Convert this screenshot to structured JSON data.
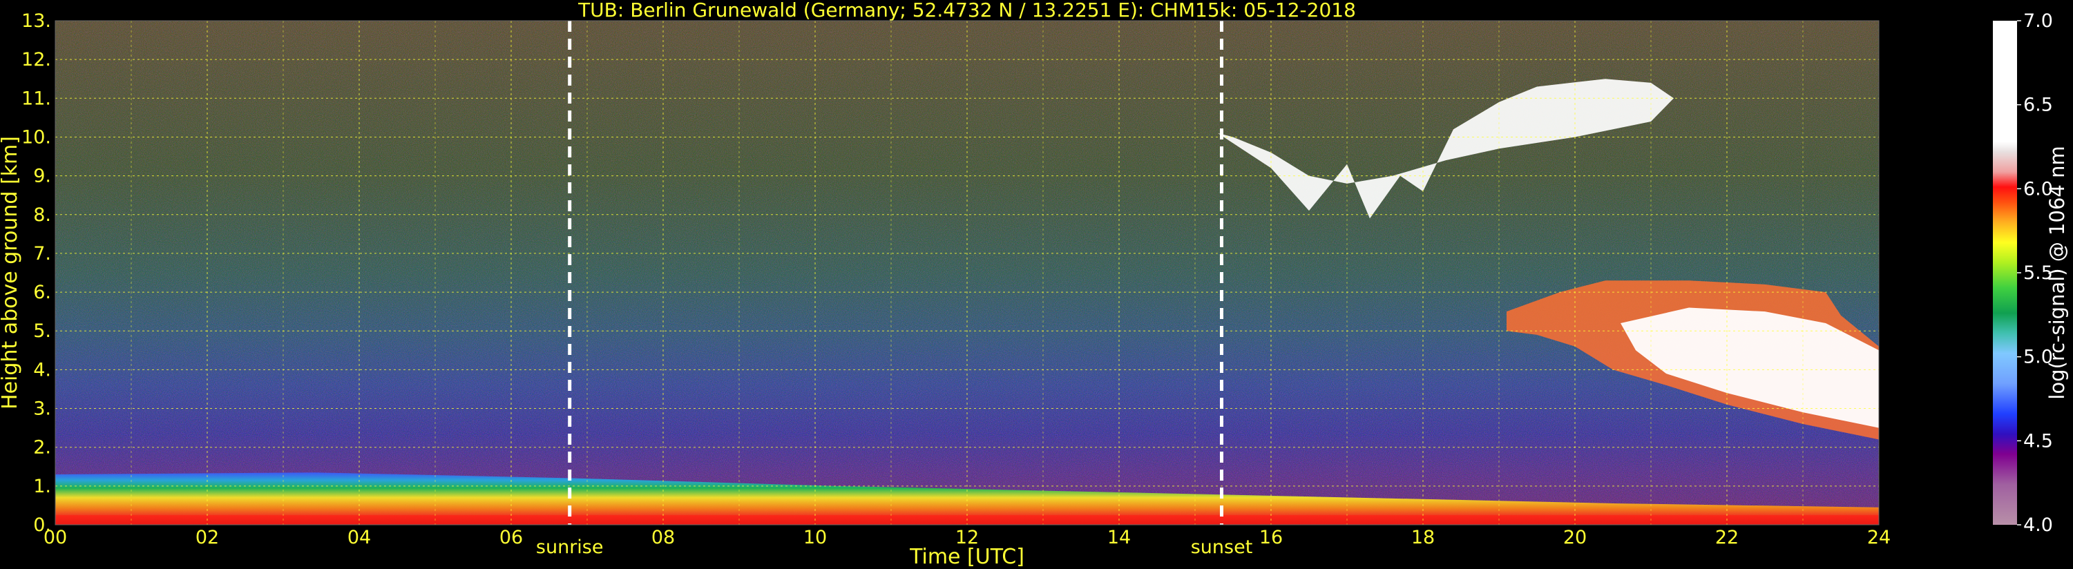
{
  "chart_data": {
    "type": "heatmap",
    "title": "TUB: Berlin Grunewald (Germany; 52.4732 N / 13.2251 E):    CHM15k: 05-12-2018",
    "xlabel": "Time [UTC]",
    "ylabel": "Height above ground [km]",
    "xlim": [
      0,
      24
    ],
    "ylim": [
      0,
      13
    ],
    "x_ticks": [
      "00",
      "02",
      "04",
      "06",
      "08",
      "10",
      "12",
      "14",
      "16",
      "18",
      "20",
      "22",
      "24"
    ],
    "y_ticks": [
      "0.",
      "1.",
      "2.",
      "3.",
      "4.",
      "5.",
      "6.",
      "7.",
      "8.",
      "9.",
      "10.",
      "11.",
      "12.",
      "13."
    ],
    "grid": true,
    "colorbar": {
      "label": "log(rc-signal) @ 1064 nm",
      "range": [
        4.0,
        7.0
      ],
      "ticks": [
        "4.0",
        "4.5",
        "5.0",
        "5.5",
        "6.0",
        "6.5",
        "7.0"
      ]
    },
    "markers": [
      {
        "label": "sunrise",
        "x": 6.77
      },
      {
        "label": "sunset",
        "x": 15.35
      }
    ],
    "features": [
      {
        "name": "boundary layer",
        "x_range": [
          0,
          24
        ],
        "top_km": [
          1.3,
          1.35,
          1.2,
          1.0,
          0.85,
          0.7,
          0.55,
          0.45
        ]
      },
      {
        "name": "upper cloud",
        "x_range": [
          15.3,
          21.3
        ],
        "height_km": [
          7.8,
          11.5
        ]
      },
      {
        "name": "mid cloud",
        "x_range": [
          19.1,
          24
        ],
        "height_km": [
          2.2,
          6.3
        ]
      }
    ]
  }
}
